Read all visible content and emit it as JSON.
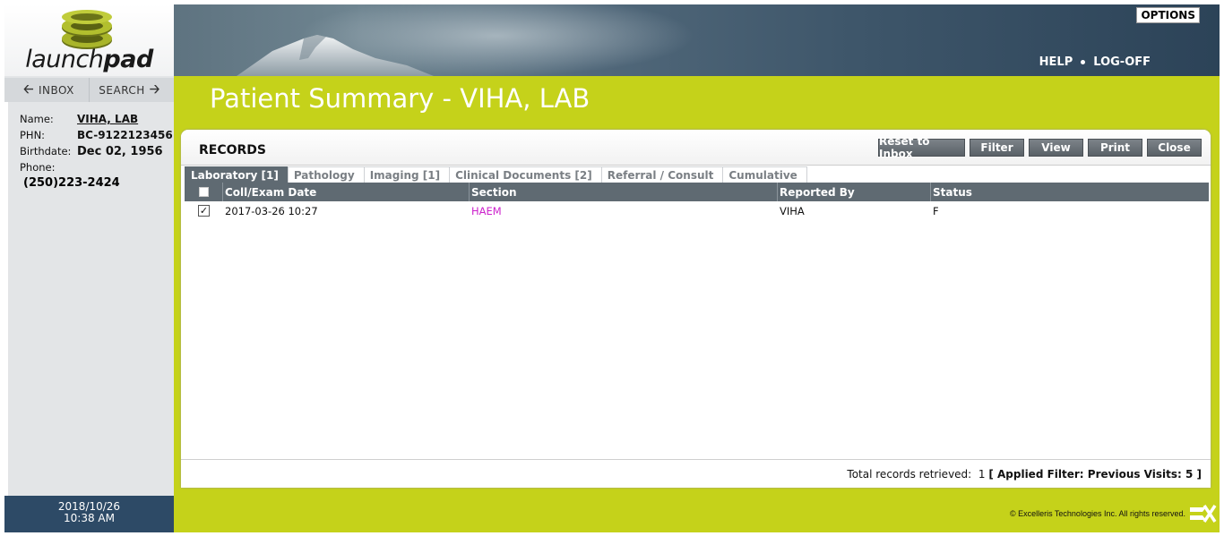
{
  "app": {
    "logo_light": "launch",
    "logo_bold": "pad",
    "options_label": "OPTIONS",
    "help_label": "HELP",
    "logoff_label": "LOG-OFF"
  },
  "nav": {
    "inbox_label": "INBOX",
    "search_label": "SEARCH"
  },
  "patient": {
    "name_label": "Name:",
    "name_value": "VIHA, LAB",
    "phn_label": "PHN:",
    "phn_value": "BC-9122123456",
    "birthdate_label": "Birthdate:",
    "birthdate_value": "Dec 02, 1956",
    "phone_label": "Phone:",
    "phone_value": "(250)223-2424"
  },
  "datetime": {
    "date": "2018/10/26",
    "time": "10:38 AM"
  },
  "page": {
    "title": "Patient Summary - VIHA, LAB"
  },
  "records": {
    "title": "RECORDS",
    "buttons": [
      "Reset to Inbox",
      "Filter",
      "View",
      "Print",
      "Close"
    ],
    "tabs": [
      "Laboratory [1]",
      "Pathology",
      "Imaging [1]",
      "Clinical Documents [2]",
      "Referral / Consult",
      "Cumulative"
    ],
    "active_tab": 0,
    "columns": [
      "Coll/Exam Date",
      "Section",
      "Reported By",
      "Status"
    ],
    "rows": [
      {
        "checked": true,
        "date": "2017-03-26 10:27",
        "section": "HAEM",
        "reported_by": "VIHA",
        "status": "F"
      }
    ],
    "footer_label": "Total records retrieved:",
    "footer_count": "1",
    "footer_filter": "[ Applied Filter: Previous Visits: 5 ]"
  },
  "footer": {
    "copyright": "© Excelleris Technologies Inc. All rights reserved."
  },
  "colors": {
    "accent_green": "#c5d21a",
    "navy": "#2d4a66",
    "grid_header": "#5f6a72",
    "section_link": "#cc22cc"
  }
}
